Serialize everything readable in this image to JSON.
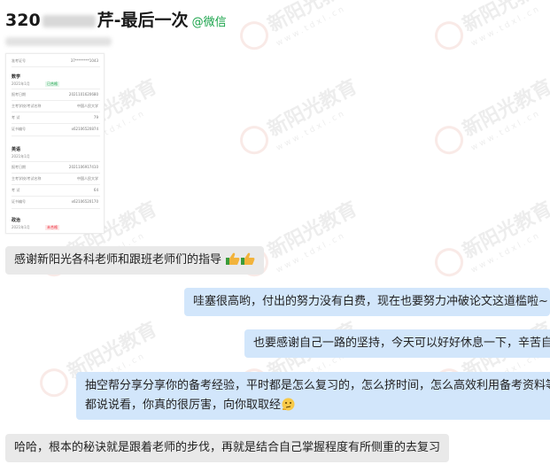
{
  "header": {
    "title_prefix": "320",
    "title_suffix": "芹-最后一次",
    "wechat_tag": "@微信"
  },
  "watermark": {
    "text": "新阳光教育",
    "url": "www.tdxl.cn"
  },
  "screenshot": {
    "rows": [
      {
        "label": "准考证号",
        "value": "37********1043"
      },
      {
        "label": "数学",
        "value": ""
      },
      {
        "label": "2021年1月",
        "value": "已合格"
      },
      {
        "label": "报考日期",
        "value": "2021101620680"
      },
      {
        "label": "主考学校/考试名称",
        "value": "中国人民大学"
      },
      {
        "label": "考 试",
        "value": "79"
      },
      {
        "label": "证书编号",
        "value": "x62106520874"
      },
      {
        "label": "英语",
        "value": ""
      },
      {
        "label": "2021年1月",
        "value": ""
      },
      {
        "label": "报考日期",
        "value": "2021106917410"
      },
      {
        "label": "主考学校/考试名称",
        "value": "中国人民大学"
      },
      {
        "label": "考 试",
        "value": "64"
      },
      {
        "label": "证书编号",
        "value": "x62106520170"
      },
      {
        "label": "政治",
        "value": ""
      },
      {
        "label": "2021年1月",
        "value": "未合格"
      }
    ]
  },
  "messages": [
    {
      "side": "left",
      "text": "感谢新阳光各科老师和跟班老师们的指导"
    },
    {
      "side": "right",
      "text": "哇塞很高哟，付出的努力没有白费，现在也要努力冲破论文这道槛啦~"
    },
    {
      "side": "right",
      "text": "也要感谢自己一路的坚持，今天可以好好休息一下，辛苦自"
    },
    {
      "side": "right",
      "text": "抽空帮分享分享你的备考经验，平时都是怎么复习的，怎么挤时间，怎么高效利用备考资料等"
    },
    {
      "side": "right",
      "text": "都说说看，你真的很厉害，向你取取经"
    },
    {
      "side": "left",
      "text": "哈哈，根本的秘诀就是跟着老师的步伐，再就是结合自己掌握程度有所侧重的去复习"
    }
  ]
}
